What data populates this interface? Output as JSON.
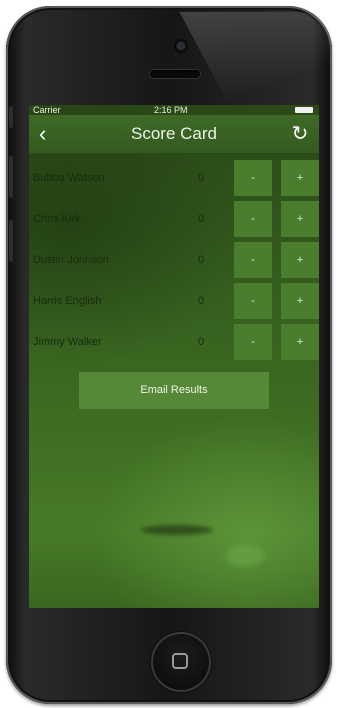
{
  "status_bar": {
    "carrier": "Carrier",
    "time": "2:16 PM"
  },
  "nav": {
    "title": "Score Card",
    "back_glyph": "‹",
    "refresh_glyph": "↻"
  },
  "players": [
    {
      "name": "Bubba Watson",
      "score": "0",
      "minus": "-",
      "plus": "+"
    },
    {
      "name": "Chris Kirk",
      "score": "0",
      "minus": "-",
      "plus": "+"
    },
    {
      "name": "Dustin Johnson",
      "score": "0",
      "minus": "-",
      "plus": "+"
    },
    {
      "name": "Harris English",
      "score": "0",
      "minus": "-",
      "plus": "+"
    },
    {
      "name": "Jimmy Walker",
      "score": "0",
      "minus": "-",
      "plus": "+"
    }
  ],
  "actions": {
    "email_label": "Email Results"
  },
  "icons": {
    "back": "chevron-left-icon",
    "refresh": "refresh-icon",
    "wifi": "wifi-icon",
    "battery": "battery-icon"
  },
  "colors": {
    "nav_bg": "#3e6a26",
    "button_bg": "#4b7d2f",
    "email_bg": "#558837"
  }
}
